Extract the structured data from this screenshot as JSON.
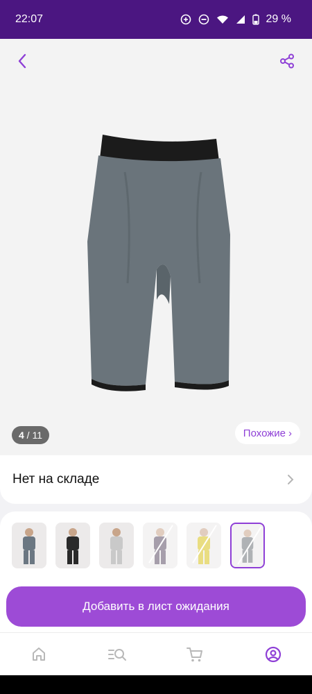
{
  "status_bar": {
    "time": "22:07",
    "battery": "29 %"
  },
  "gallery": {
    "counter_current": "4",
    "counter_sep": " / ",
    "counter_total": "11",
    "similar_label": "Похожие",
    "similar_chevron": "›"
  },
  "stock": {
    "status": "Нет на складе"
  },
  "thumbnails": [
    {
      "name": "thumb-1",
      "selected": false,
      "unavailable": false,
      "color": "#6b7782"
    },
    {
      "name": "thumb-2",
      "selected": false,
      "unavailable": false,
      "color": "#2a2a2a"
    },
    {
      "name": "thumb-3",
      "selected": false,
      "unavailable": false,
      "color": "#c9c9c9"
    },
    {
      "name": "thumb-4",
      "selected": false,
      "unavailable": true,
      "color": "#5d4f66"
    },
    {
      "name": "thumb-5",
      "selected": false,
      "unavailable": true,
      "color": "#d8c11a"
    },
    {
      "name": "thumb-6",
      "selected": true,
      "unavailable": true,
      "color": "#6d7378"
    }
  ],
  "cta": {
    "label": "Добавить в лист ожидания"
  },
  "nav": {
    "items": [
      "home-icon",
      "catalog-search-icon",
      "cart-icon",
      "profile-icon"
    ],
    "active": "profile-icon"
  },
  "colors": {
    "accent": "#9d4bd6",
    "status_bar": "#4b1681",
    "product": "#6a747b"
  }
}
